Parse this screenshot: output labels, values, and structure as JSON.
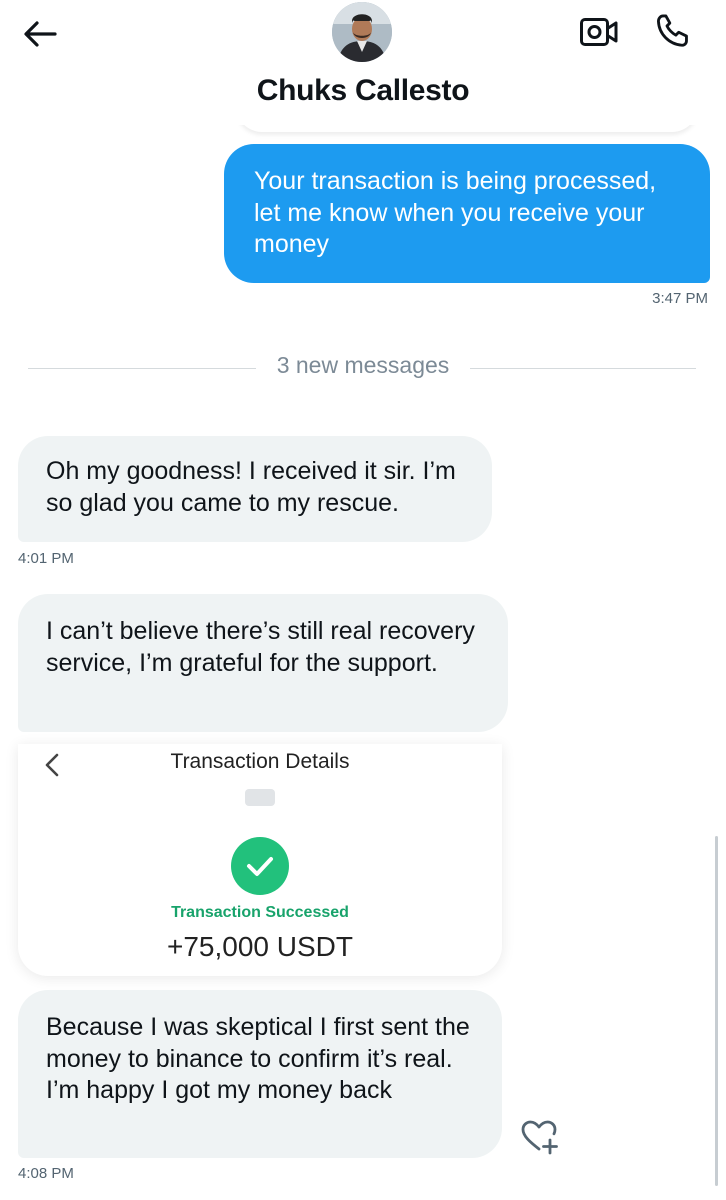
{
  "conversation": {
    "contact_name": "Chuks Callesto"
  },
  "header": {
    "back_icon": "arrow-left-icon",
    "video_icon": "video-camera-icon",
    "call_icon": "phone-icon"
  },
  "messages": [
    {
      "direction": "sent",
      "text": "Your transaction is being processed, let me know when you receive your money",
      "time": "3:47 PM"
    },
    {
      "direction": "received",
      "text": "Oh my goodness! I received it sir. I’m so glad you came to my rescue.",
      "time": "4:01 PM"
    },
    {
      "direction": "received",
      "text": "I can’t believe there’s still real recovery service, I’m grateful for the support.",
      "time": ""
    },
    {
      "direction": "received",
      "text": "Because I was skeptical I first sent the money to binance to confirm it’s real. I’m happy I got my money back",
      "time": "4:08 PM"
    }
  ],
  "divider": {
    "label": "3 new messages"
  },
  "attachment": {
    "title": "Transaction Details",
    "status": "Transaction Successed",
    "amount": "+75,000 USDT",
    "status_color": "#18a36b",
    "check_color": "#22c17c"
  },
  "colors": {
    "sent_bubble": "#1d9bf0",
    "received_bubble": "#eff3f4",
    "text": "#0f1419",
    "meta_text": "#536471"
  }
}
